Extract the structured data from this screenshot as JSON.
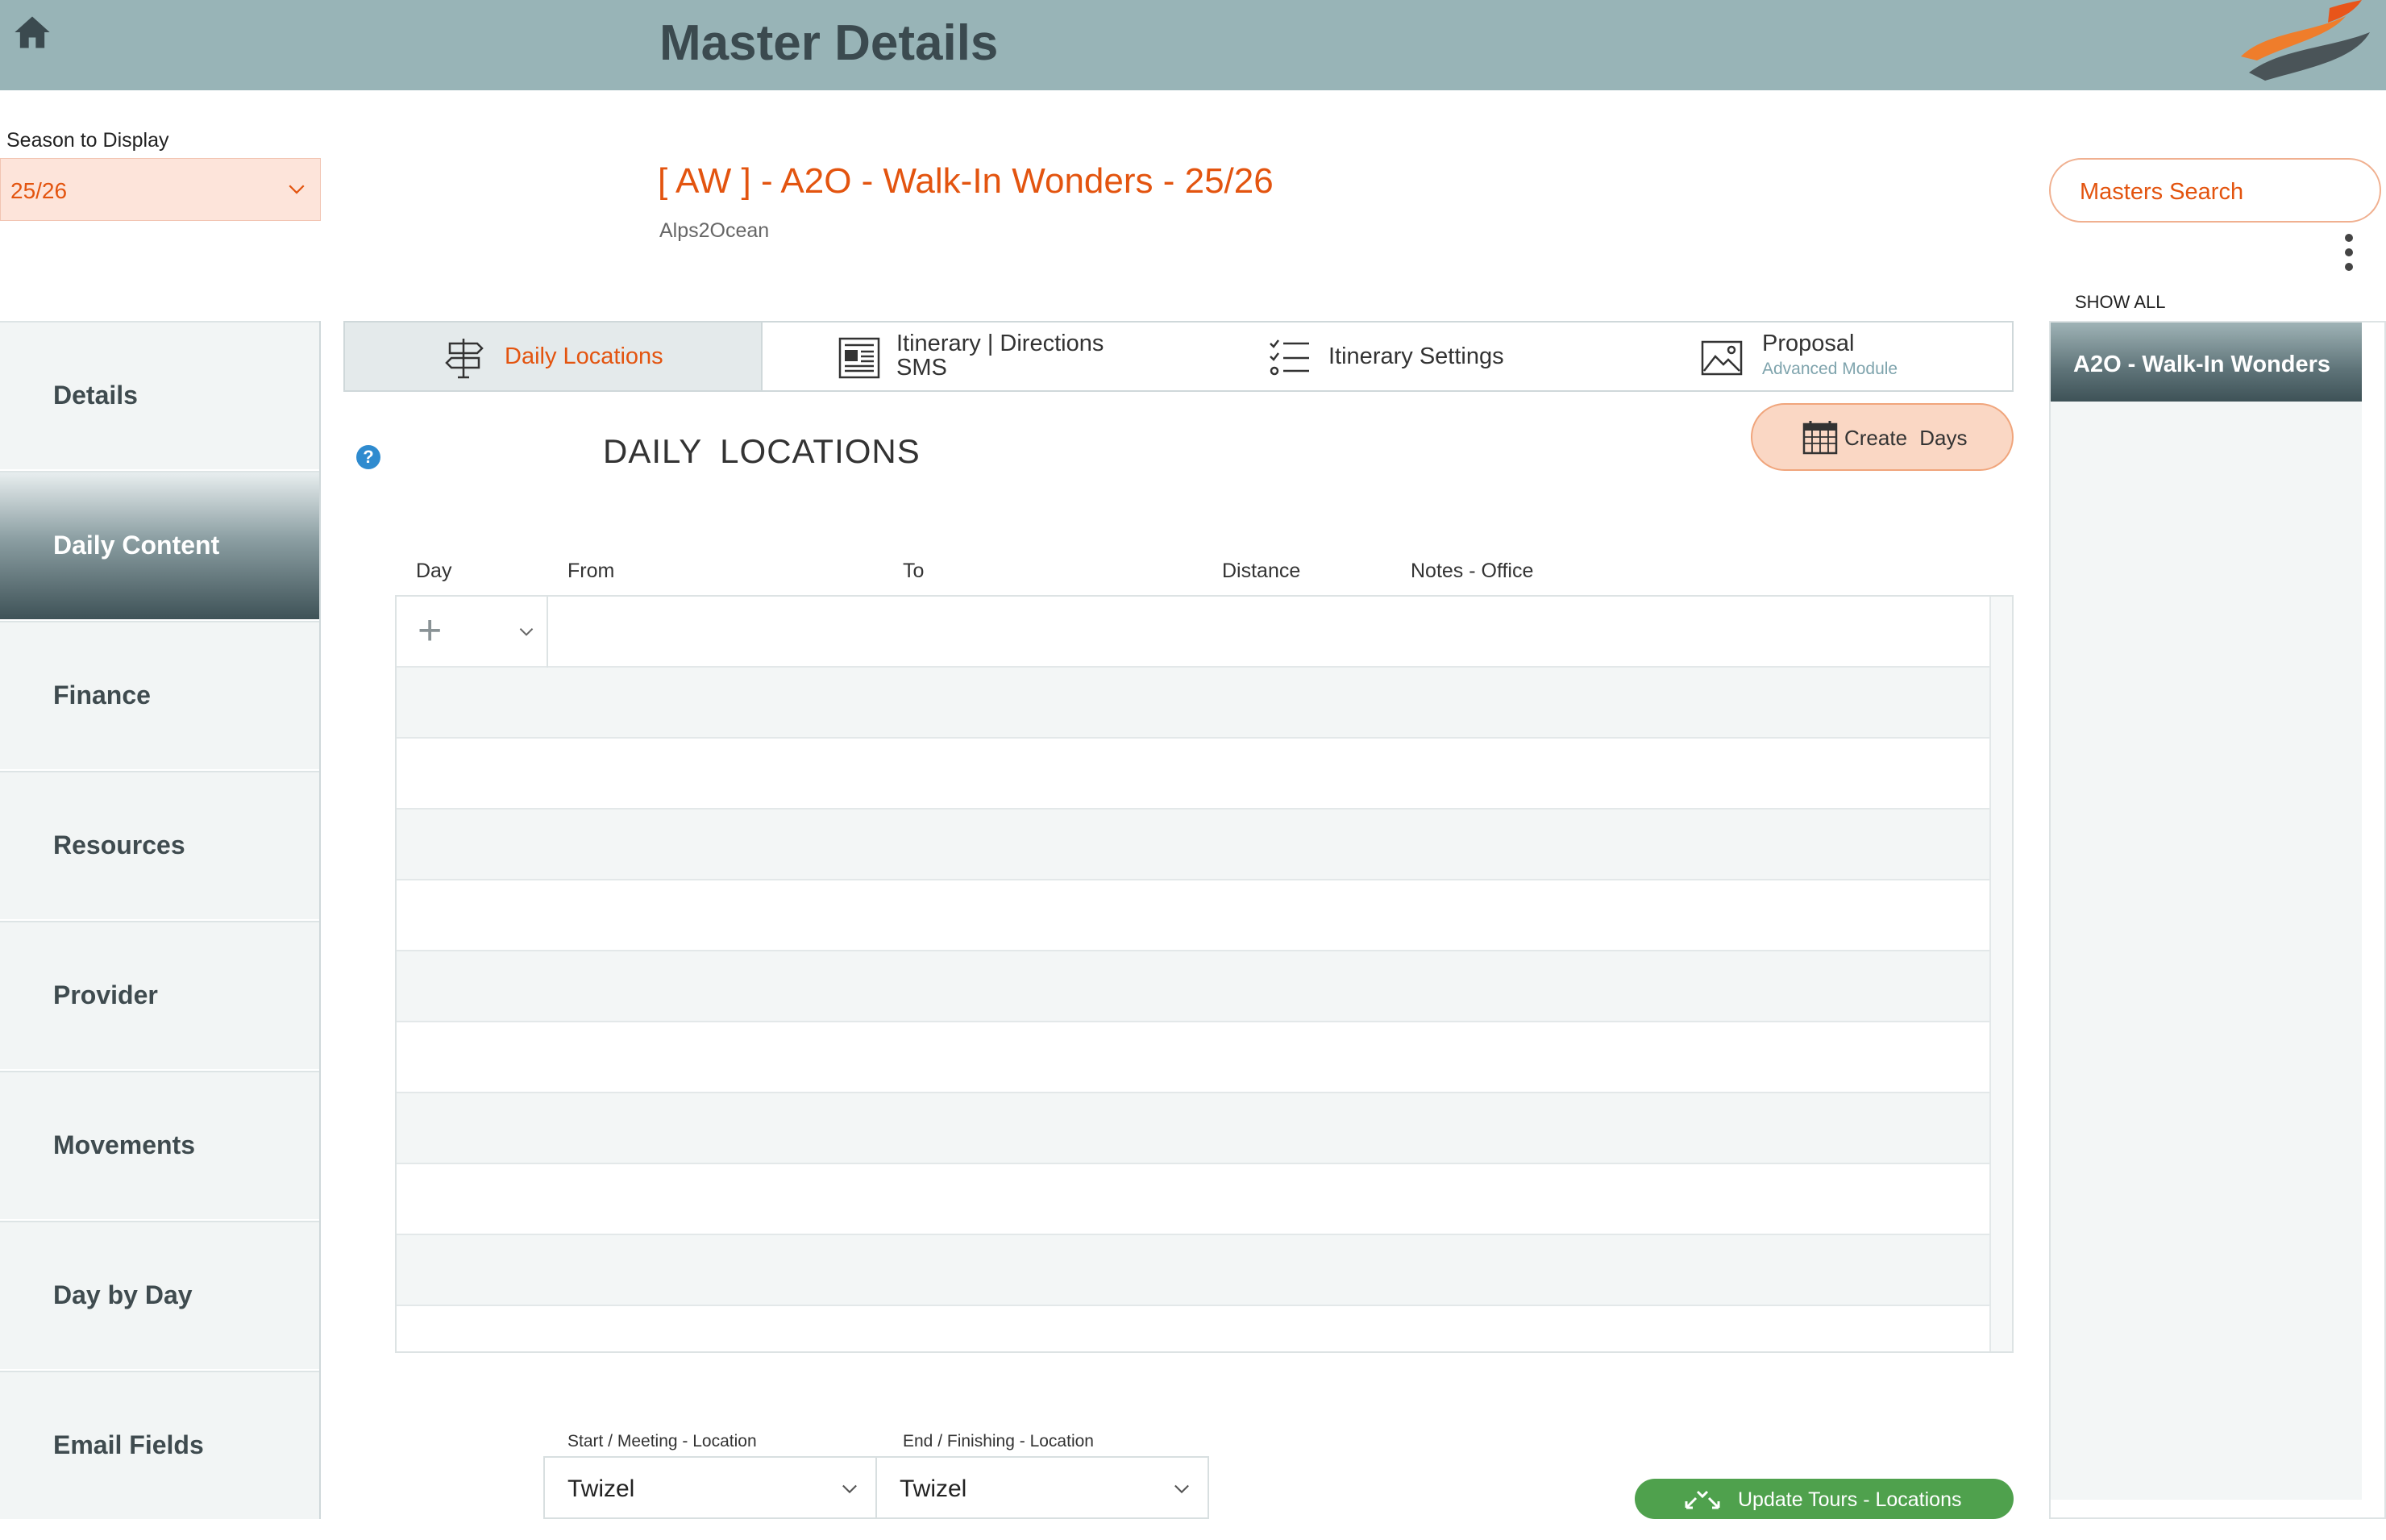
{
  "header": {
    "title": "Master Details",
    "home_icon": "home-icon",
    "logo_icon": "swoosh-logo"
  },
  "season": {
    "label": "Season to Display",
    "value": "25/26"
  },
  "master": {
    "title": "[ AW ] - A2O - Walk-In Wonders - 25/26",
    "subtitle": "Alps2Ocean"
  },
  "search": {
    "label": "Masters Search"
  },
  "right_panel": {
    "show_all": "SHOW ALL",
    "items": [
      {
        "label": "A2O - Walk-In Wonders",
        "active": true
      }
    ]
  },
  "sidebar": {
    "items": [
      {
        "label": "Details",
        "active": false
      },
      {
        "label": "Daily Content",
        "active": true
      },
      {
        "label": "Finance",
        "active": false
      },
      {
        "label": "Resources",
        "active": false
      },
      {
        "label": "Provider",
        "active": false
      },
      {
        "label": "Movements",
        "active": false
      },
      {
        "label": "Day by Day",
        "active": false
      },
      {
        "label": "Email Fields",
        "active": false
      }
    ]
  },
  "tabs": [
    {
      "label": "Daily Locations",
      "active": true,
      "icon": "signpost-icon"
    },
    {
      "label": "Itinerary | Directions",
      "label2": "SMS",
      "active": false,
      "icon": "newspaper-icon"
    },
    {
      "label": "Itinerary Settings",
      "active": false,
      "icon": "checklist-icon"
    },
    {
      "label": "Proposal",
      "sub": "Advanced Module",
      "active": false,
      "icon": "image-icon"
    }
  ],
  "daily_locations": {
    "title": "DAILY  LOCATIONS",
    "help_icon": "?",
    "create_days": "Create  Days",
    "columns": [
      "Day",
      "From",
      "To",
      "Distance",
      "Notes - Office"
    ],
    "rows": []
  },
  "bottom": {
    "start_label": "Start / Meeting - Location",
    "start_value": "Twizel",
    "end_label": "End / Finishing - Location",
    "end_value": "Twizel",
    "update_button": "Update Tours - Locations"
  },
  "colors": {
    "header_bg": "#98b4b7",
    "accent": "#e3540f",
    "update_green": "#4fa14d"
  }
}
